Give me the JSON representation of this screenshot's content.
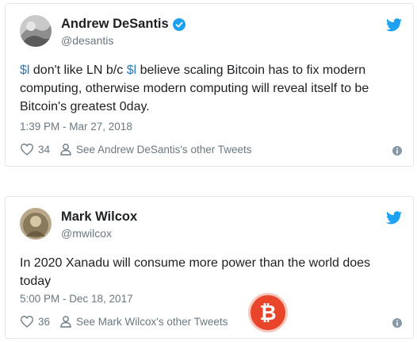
{
  "colors": {
    "accent": "#1da1f2",
    "link": "#2b7bb9",
    "muted": "#697882",
    "text": "#1c2022",
    "watermark": "#e8452b"
  },
  "tweets": [
    {
      "name": "Andrew DeSantis",
      "verified": true,
      "handle": "@desantis",
      "text_parts": [
        {
          "cashtag": "$l"
        },
        {
          "text": " don't like LN b/c "
        },
        {
          "cashtag": "$l"
        },
        {
          "text": " believe scaling Bitcoin has to fix modern computing, otherwise modern computing will reveal itself to be Bitcoin's greatest 0day."
        }
      ],
      "time": "1:39 PM - Mar 27, 2018",
      "likes": "34",
      "other_tweets_label": "See Andrew DeSantis's other Tweets"
    },
    {
      "name": "Mark Wilcox",
      "verified": false,
      "handle": "@mwilcox",
      "text": "In 2020 Xanadu will consume more power than the world does today",
      "time": "5:00 PM - Dec 18, 2017",
      "likes": "36",
      "other_tweets_label": "See Mark Wilcox's other Tweets"
    }
  ],
  "watermark": {
    "glyph": "₿"
  }
}
